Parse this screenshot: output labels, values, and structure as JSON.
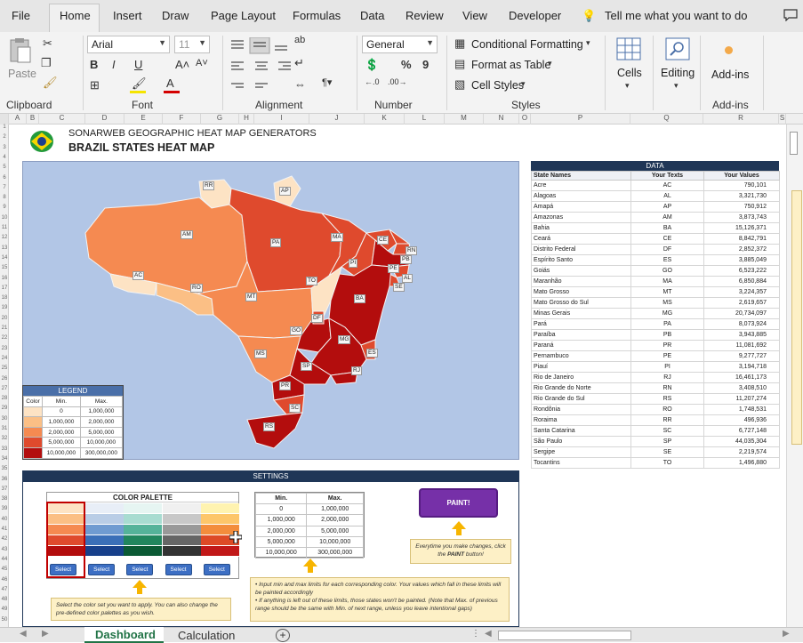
{
  "menu": [
    "File",
    "Home",
    "Insert",
    "Draw",
    "Page Layout",
    "Formulas",
    "Data",
    "Review",
    "View",
    "Developer"
  ],
  "tell_me": "Tell me what you want to do",
  "ribbon": {
    "clipboard": {
      "paste": "Paste",
      "group": "Clipboard"
    },
    "font": {
      "name": "Arial",
      "size": "11",
      "group": "Font"
    },
    "alignment": {
      "group": "Alignment"
    },
    "number": {
      "format": "General",
      "group": "Number"
    },
    "styles": {
      "conditional": "Conditional Formatting",
      "format_table": "Format as Table",
      "cell_styles": "Cell Styles",
      "group": "Styles"
    },
    "cells": {
      "label": "Cells"
    },
    "editing": {
      "label": "Editing"
    },
    "addins": {
      "label": "Add-ins",
      "group": "Add-ins"
    }
  },
  "columns": [
    "A",
    "B",
    "C",
    "D",
    "E",
    "F",
    "G",
    "H",
    "I",
    "J",
    "K",
    "L",
    "M",
    "N",
    "O",
    "P",
    "Q",
    "R",
    "S"
  ],
  "rows": [
    "1",
    "2",
    "3",
    "4",
    "5",
    "6",
    "7",
    "8",
    "9",
    "10",
    "11",
    "12",
    "13",
    "14",
    "15",
    "16",
    "17",
    "18",
    "19",
    "20",
    "21",
    "22",
    "23",
    "24",
    "25",
    "26",
    "27",
    "28",
    "29",
    "30",
    "31",
    "32",
    "33",
    "34",
    "35",
    "36",
    "37",
    "38",
    "39",
    "40",
    "41",
    "42",
    "43",
    "44",
    "45",
    "46",
    "47",
    "48",
    "49",
    "50"
  ],
  "sheet": {
    "title1": "SONARWEB GEOGRAPHIC HEAT MAP GENERATORS",
    "title2": "BRAZIL STATES HEAT MAP"
  },
  "map_labels": [
    "RR",
    "AP",
    "AM",
    "PA",
    "MA",
    "CE",
    "RN",
    "PB",
    "PE",
    "AL",
    "SE",
    "PI",
    "AC",
    "RO",
    "TO",
    "BA",
    "MT",
    "DF",
    "GO",
    "MG",
    "ES",
    "MS",
    "SP",
    "RJ",
    "PR",
    "SC",
    "RS"
  ],
  "legend": {
    "title": "LEGEND",
    "headers": [
      "Color",
      "Min.",
      "Max."
    ],
    "rows": [
      [
        "0",
        "1,000,000"
      ],
      [
        "1,000,000",
        "2,000,000"
      ],
      [
        "2,000,000",
        "5,000,000"
      ],
      [
        "5,000,000",
        "10,000,000"
      ],
      [
        "10,000,000",
        "300,000,000"
      ]
    ],
    "colors": [
      "#fde3c4",
      "#fbbf85",
      "#f58a51",
      "#df4a2d",
      "#b30d0d"
    ]
  },
  "data_table": {
    "title": "DATA",
    "headers": [
      "State Names",
      "Your Texts",
      "Your Values"
    ],
    "rows": [
      [
        "Acre",
        "AC",
        "790,101"
      ],
      [
        "Alagoas",
        "AL",
        "3,321,730"
      ],
      [
        "Amapá",
        "AP",
        "750,912"
      ],
      [
        "Amazonas",
        "AM",
        "3,873,743"
      ],
      [
        "Bahia",
        "BA",
        "15,126,371"
      ],
      [
        "Ceará",
        "CE",
        "8,842,791"
      ],
      [
        "Distrito Federal",
        "DF",
        "2,852,372"
      ],
      [
        "Espírito Santo",
        "ES",
        "3,885,049"
      ],
      [
        "Goiás",
        "GO",
        "6,523,222"
      ],
      [
        "Maranhão",
        "MA",
        "6,850,884"
      ],
      [
        "Mato Grosso",
        "MT",
        "3,224,357"
      ],
      [
        "Mato Grosso do Sul",
        "MS",
        "2,619,657"
      ],
      [
        "Minas Gerais",
        "MG",
        "20,734,097"
      ],
      [
        "Pará",
        "PA",
        "8,073,924"
      ],
      [
        "Paraíba",
        "PB",
        "3,943,885"
      ],
      [
        "Paraná",
        "PR",
        "11,081,692"
      ],
      [
        "Pernambuco",
        "PE",
        "9,277,727"
      ],
      [
        "Piauí",
        "PI",
        "3,194,718"
      ],
      [
        "Rio de Janeiro",
        "RJ",
        "16,461,173"
      ],
      [
        "Rio Grande do Norte",
        "RN",
        "3,408,510"
      ],
      [
        "Rio Grande do Sul",
        "RS",
        "11,207,274"
      ],
      [
        "Rondônia",
        "RO",
        "1,748,531"
      ],
      [
        "Roraima",
        "RR",
        "496,936"
      ],
      [
        "Santa Catarina",
        "SC",
        "6,727,148"
      ],
      [
        "São Paulo",
        "SP",
        "44,035,304"
      ],
      [
        "Sergipe",
        "SE",
        "2,219,574"
      ],
      [
        "Tocantins",
        "TO",
        "1,496,880"
      ]
    ]
  },
  "settings": {
    "title": "SETTINGS",
    "palette_title": "COLOR PALETTE",
    "select_label": "Select",
    "palettes": [
      [
        "#fde3c4",
        "#fbbf85",
        "#f58a51",
        "#df4a2d",
        "#b30d0d"
      ],
      [
        "#e8eef7",
        "#b9cde6",
        "#6f9bd1",
        "#3a6fb8",
        "#17408b"
      ],
      [
        "#e6f5f2",
        "#a8dcd1",
        "#55b39a",
        "#21865e",
        "#0b5a35"
      ],
      [
        "#f0f0f0",
        "#c8c8c8",
        "#999999",
        "#666666",
        "#333333"
      ],
      [
        "#fff3b0",
        "#fdc66a",
        "#f38d3c",
        "#dd4a26",
        "#c11818"
      ]
    ],
    "minmax_headers": [
      "Min.",
      "Max."
    ],
    "minmax_rows": [
      [
        "0",
        "1,000,000"
      ],
      [
        "1,000,000",
        "2,000,000"
      ],
      [
        "2,000,000",
        "5,000,000"
      ],
      [
        "5,000,000",
        "10,000,000"
      ],
      [
        "10,000,000",
        "300,000,000"
      ]
    ],
    "paint": "PAINT!",
    "note_paint_a": "Everytime you make changes, click",
    "note_paint_b": "the ",
    "note_paint_strong": "PAINT",
    "note_paint_c": " button!",
    "note_select": "Select the color set you want to apply. You can also change the pre-defined color palettes as you wish.",
    "note_minmax_1": "Input min and max limits for each corresponding color. Your values which fall in these limits will be painted accordingly",
    "note_minmax_2": "If anything is left out of these limits, those states won't be painted. (Note that Max. of previous range should be the same with Min. of next range, unless you leave intentional gaps)"
  },
  "sheet_tabs": [
    "Dashboard",
    "Calculation"
  ]
}
